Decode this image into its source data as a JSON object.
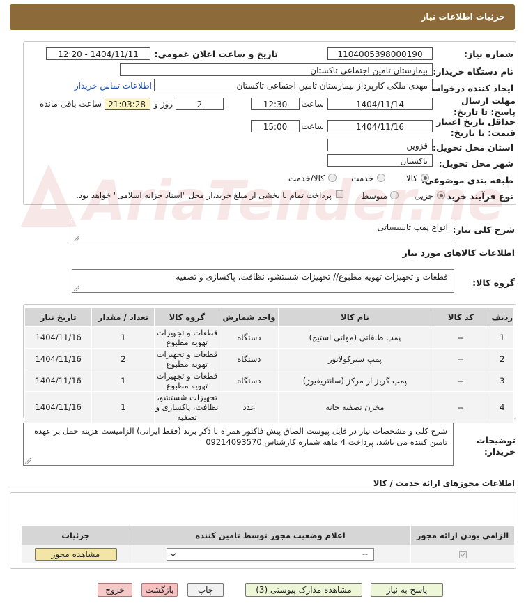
{
  "header": {
    "title": "جزئیات اطلاعات نیاز"
  },
  "form": {
    "need_number_label": "شماره نیاز:",
    "need_number": "1104005398000190",
    "announce_label": "تاریخ و ساعت اعلان عمومی:",
    "announce_value": "1404/11/11 - 12:20",
    "buyer_label": "نام دستگاه خریدار:",
    "buyer_value": "بیمارستان تامین اجتماعی تاکستان",
    "creator_label": "ایجاد کننده درخواست:",
    "creator_value": "مهدی ملکی کارپرداز بیمارستان تامین اجتماعی تاکستان",
    "contact_link": "اطلاعات تماس خریدار",
    "deadline_label": "مهلت ارسال پاسخ: تا تاریخ:",
    "deadline_date": "1404/11/14",
    "time_label": "ساعت",
    "deadline_time": "12:30",
    "days_value": "2",
    "days_label": "روز و",
    "remaining_time": "21:03:28",
    "remaining_label": "ساعت باقی مانده",
    "validity_label": "حداقل تاریخ اعتبار قیمت: تا تاریخ:",
    "validity_date": "1404/11/16",
    "validity_time_label": "ساعت",
    "validity_time": "15:00",
    "province_label": "استان محل تحویل:",
    "province_value": "قزوین",
    "city_label": "شهر محل تحویل:",
    "city_value": "تاکستان",
    "category_label": "طبقه بندی موضوعی:",
    "category_options": [
      "کالا",
      "خدمت",
      "کالا/خدمت"
    ],
    "category_selected": "کالا",
    "process_label": "نوع فرآیند خرید :",
    "process_options": [
      "جزیی",
      "متوسط"
    ],
    "process_selected": "جزیی",
    "payment_note": "پرداخت تمام یا بخشی از مبلغ خرید،از محل \"اسناد خزانه اسلامی\" خواهد بود."
  },
  "summary": {
    "label": "شرح کلی نیاز:",
    "value": "انواع پمپ تاسیساتی"
  },
  "goods": {
    "section_title": "اطلاعات کالاهای مورد نیاز",
    "group_label": "گروه کالا:",
    "group_value": "قطعات و تجهیزات تهویه مطبوع// تجهیزات شستشو، نظافت، پاکسازی و تصفیه",
    "columns": [
      "ردیف",
      "کد کالا",
      "نام کالا",
      "واحد شمارش",
      "گروه کالا",
      "تعداد / مقدار",
      "تاریخ نیاز"
    ],
    "rows": [
      [
        "1",
        "--",
        "پمپ طبقاتی (مولتی استیج)",
        "دستگاه",
        "قطعات و تجهیزات تهویه مطبوع",
        "1",
        "1404/11/16"
      ],
      [
        "2",
        "--",
        "پمپ سیرکولاتور",
        "دستگاه",
        "قطعات و تجهیزات تهویه مطبوع",
        "2",
        "1404/11/16"
      ],
      [
        "3",
        "--",
        "پمپ گریز از مرکز (سانتریفیوژ)",
        "دستگاه",
        "قطعات و تجهیزات تهویه مطبوع",
        "1",
        "1404/11/16"
      ],
      [
        "4",
        "--",
        "مخزن تصفیه خانه",
        "عدد",
        "تجهیزات شستشو، نظافت، پاکسازی و تصفیه",
        "1",
        "1404/11/16"
      ]
    ]
  },
  "buyer_notes": {
    "label": "توضیحات خریدار:",
    "value": "شرح کلی و مشخصات نیاز در فایل پیوست  الصاق پیش فاکتور همراه با ذکر برند (فقط ایرانی) الزامیست هزینه حمل بر عهده تامین کننده می باشد.  پرداخت 4 ماهه  شماره کارشناس 09214093570"
  },
  "permits": {
    "title": "اطلاعات مجوزهای ارائه خدمت / کالا",
    "columns": [
      "الزامی بودن ارائه مجوز",
      "اعلام وضعیت مجوز توسط تامین کننده",
      "جزئیات"
    ],
    "select_value": "--",
    "view_button": "مشاهده مجوز"
  },
  "footer": {
    "reply": "پاسخ به نیاز",
    "attachments": "مشاهده مدارک پیوستی (3)",
    "print": "چاپ",
    "back": "بازگشت",
    "exit": "خروج"
  },
  "watermark": {
    "text": "AriaTender.neT"
  }
}
